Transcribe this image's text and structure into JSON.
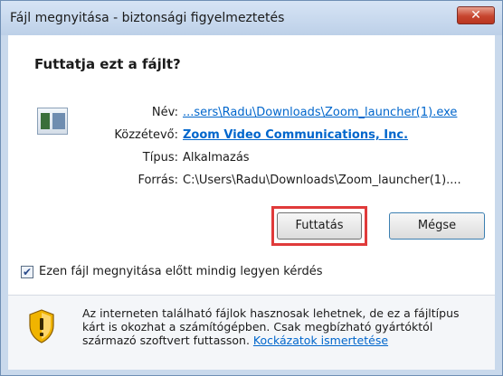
{
  "window": {
    "title": "Fájl megnyitása - biztonsági figyelmeztetés",
    "close_glyph": "✕"
  },
  "dialog": {
    "heading": "Futtatja ezt a fájlt?",
    "fields": {
      "name_label": "Név:",
      "name_value": "...sers\\Radu\\Downloads\\Zoom_launcher(1).exe",
      "publisher_label": "Közzétevő:",
      "publisher_value": "Zoom Video Communications, Inc.",
      "type_label": "Típus:",
      "type_value": "Alkalmazás",
      "source_label": "Forrás:",
      "source_value": "C:\\Users\\Radu\\Downloads\\Zoom_launcher(1)...."
    },
    "buttons": {
      "run": "Futtatás",
      "cancel": "Mégse"
    },
    "checkbox": {
      "checked": true,
      "label": "Ezen fájl megnyitása előtt mindig legyen kérdés"
    },
    "warning": {
      "text": "Az interneten található fájlok hasznosak lehetnek, de ez a fájltípus kárt is okozhat a számítógépben. Csak megbízható gyártóktól származó szoftvert futtasson. ",
      "link": "Kockázatok ismertetése"
    }
  },
  "icons": {
    "app": "application-icon",
    "warning": "security-shield-icon",
    "check": "checkmark-icon"
  },
  "colors": {
    "link": "#0066cc",
    "highlight": "#e03a3a",
    "close_button": "#c7452f"
  }
}
